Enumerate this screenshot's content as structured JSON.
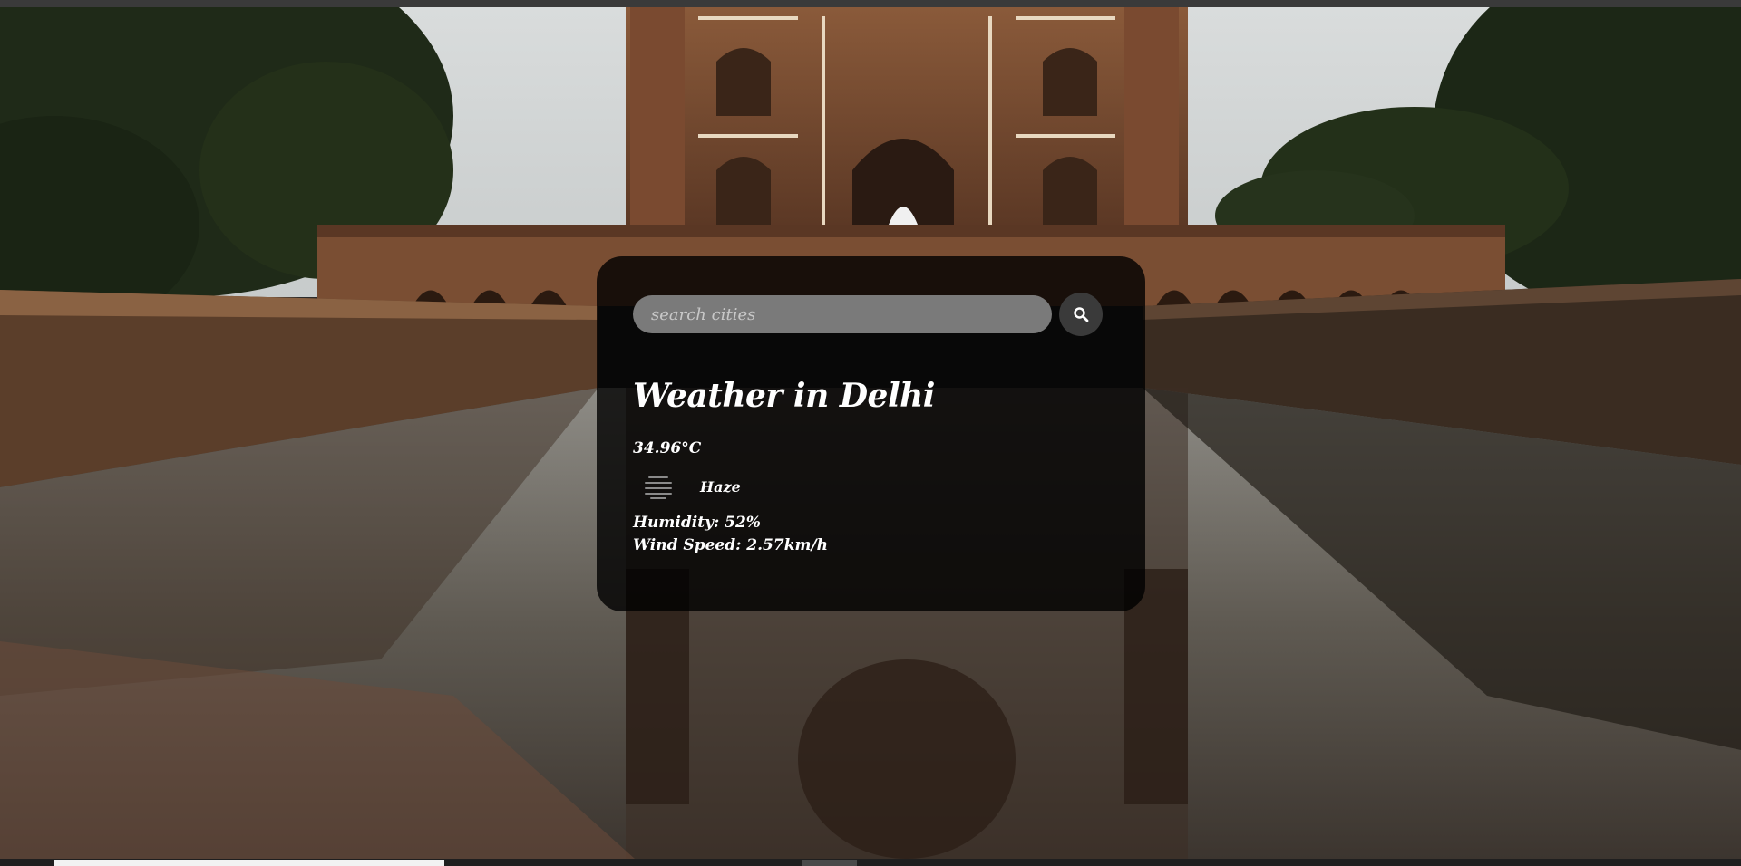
{
  "search": {
    "placeholder": "search cities",
    "button_icon": "search-icon"
  },
  "weather": {
    "title": "Weather in Delhi",
    "temperature": "34.96°C",
    "condition": "Haze",
    "condition_icon": "haze-icon",
    "humidity": "Humidity: 52%",
    "wind_speed": "Wind Speed: 2.57km/h"
  },
  "background": {
    "image": "tomb-reflection-pool-photo"
  }
}
